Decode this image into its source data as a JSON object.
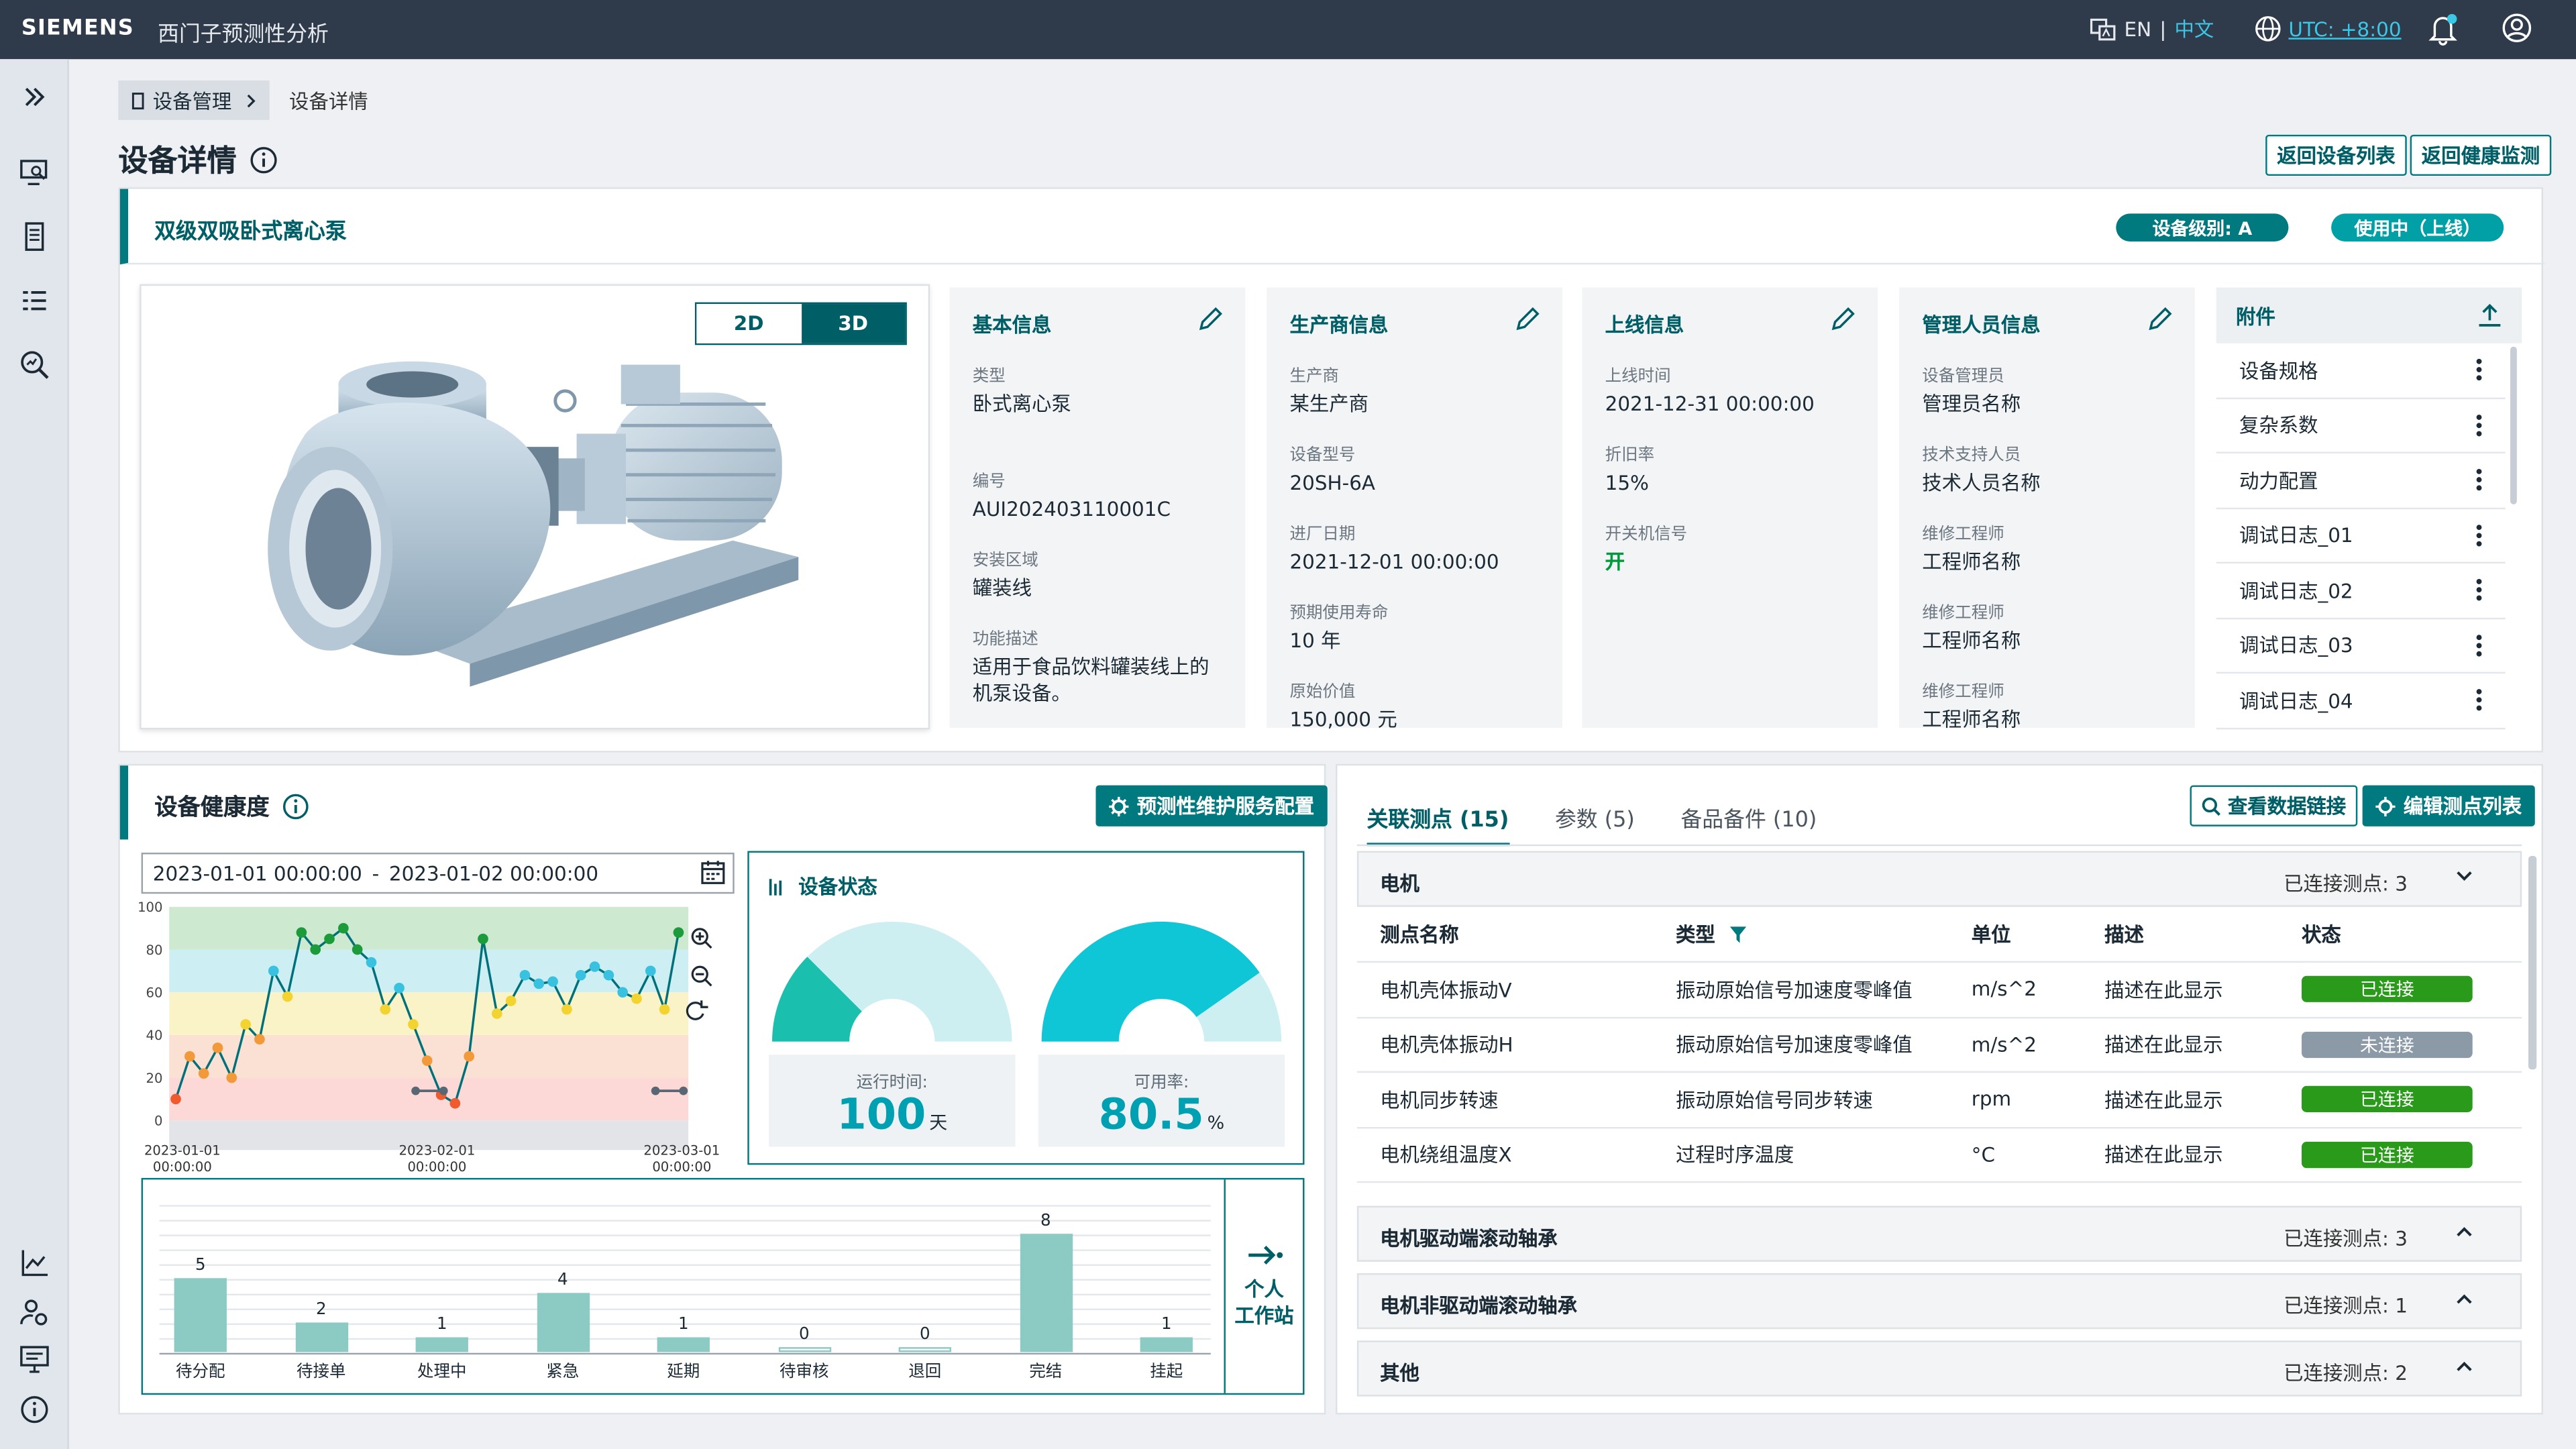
{
  "topbar": {
    "brand": "SIEMENS",
    "title": "西门子预测性分析",
    "lang_en": "EN",
    "lang_sep": "|",
    "lang_cn": "中文",
    "timezone": "UTC: +8:00"
  },
  "breadcrumb": {
    "parent": "设备管理",
    "current": "设备详情"
  },
  "page": {
    "title": "设备详情",
    "btn_list": "返回设备列表",
    "btn_health": "返回健康监测"
  },
  "equipment": {
    "name": "双级双吸卧式离心泵",
    "level": "设备级别: A",
    "status": "使用中（上线）",
    "view_2d": "2D",
    "view_3d": "3D"
  },
  "basic": {
    "title": "基本信息",
    "type_label": "类型",
    "type_value": "卧式离心泵",
    "code_label": "编号",
    "code_value": "AUI202403110001C",
    "area_label": "安装区域",
    "area_value": "罐装线",
    "desc_label": "功能描述",
    "desc_value": "适用于食品饮料罐装线上的机泵设备。"
  },
  "maker": {
    "title": "生产商信息",
    "maker_label": "生产商",
    "maker_value": "某生产商",
    "model_label": "设备型号",
    "model_value": "20SH-6A",
    "date_label": "进厂日期",
    "date_value": "2021-12-01 00:00:00",
    "life_label": "预期使用寿命",
    "life_value": "10 年",
    "price_label": "原始价值",
    "price_value": "150,000 元"
  },
  "online": {
    "title": "上线信息",
    "time_label": "上线时间",
    "time_value": "2021-12-31 00:00:00",
    "dep_label": "折旧率",
    "dep_value": "15%",
    "sig_label": "开关机信号",
    "sig_value": "开"
  },
  "staff": {
    "title": "管理人员信息",
    "mgr_label": "设备管理员",
    "mgr_value": "管理员名称",
    "tech_label": "技术支持人员",
    "tech_value": "技术人员名称",
    "eng1_label": "维修工程师",
    "eng1_value": "工程师名称",
    "eng2_label": "维修工程师",
    "eng2_value": "工程师名称",
    "eng3_label": "维修工程师",
    "eng3_value": "工程师名称"
  },
  "attachments": {
    "title": "附件",
    "items": [
      "设备规格",
      "复杂系数",
      "动力配置",
      "调试日志_01",
      "调试日志_02",
      "调试日志_03",
      "调试日志_04"
    ]
  },
  "health": {
    "title": "设备健康度",
    "config_btn": "预测性维护服务配置",
    "date_start": "2023-01-01  00:00:00",
    "date_sep": "-",
    "date_end": "2023-01-02  00:00:00",
    "status_title": "设备状态",
    "run_label": "运行时间:",
    "run_value": "100",
    "run_unit": "天",
    "avail_label": "可用率:",
    "avail_value": "80.5",
    "avail_unit": "%",
    "runtime_fraction": 0.25,
    "availability_fraction": 0.805,
    "workstation_1": "个人",
    "workstation_2": "工作站"
  },
  "chart_data": [
    {
      "type": "line",
      "ylim": [
        0,
        100
      ],
      "yticks": [
        "100",
        "80",
        "60",
        "40",
        "20",
        "0"
      ],
      "xticks": [
        {
          "d": "2023-01-01",
          "t": "00:00:00"
        },
        {
          "d": "2023-02-01",
          "t": "00:00:00"
        },
        {
          "d": "2023-03-01",
          "t": "00:00:00"
        }
      ],
      "values": [
        10,
        30,
        22,
        34,
        20,
        45,
        38,
        70,
        58,
        88,
        80,
        85,
        90,
        80,
        74,
        52,
        62,
        45,
        28,
        12,
        8,
        30,
        85,
        50,
        56,
        68,
        64,
        65,
        52,
        68,
        72,
        68,
        60,
        57,
        70,
        52,
        88
      ],
      "bands": [
        {
          "from": 80,
          "to": 100,
          "color": "#cde9cf"
        },
        {
          "from": 60,
          "to": 80,
          "color": "#cdeff4"
        },
        {
          "from": 40,
          "to": 60,
          "color": "#fbf3c8"
        },
        {
          "from": 20,
          "to": 40,
          "color": "#fbe1d3"
        },
        {
          "from": 0,
          "to": 20,
          "color": "#fcd9d6"
        }
      ]
    },
    {
      "type": "bar",
      "categories": [
        "待分配",
        "待接单",
        "处理中",
        "紧急",
        "延期",
        "待审核",
        "退回",
        "完结",
        "挂起"
      ],
      "values": [
        5,
        2,
        1,
        4,
        1,
        0,
        0,
        8,
        1
      ]
    }
  ],
  "points": {
    "tabs": [
      "关联测点 (15)",
      "参数 (5)",
      "备品备件 (10)"
    ],
    "btn_view": "查看数据链接",
    "btn_edit": "编辑测点列表",
    "group1": {
      "name": "电机",
      "count": "已连接测点: 3"
    },
    "columns": [
      "测点名称",
      "类型",
      "单位",
      "描述",
      "状态"
    ],
    "rows": [
      {
        "name": "电机壳体振动V",
        "type": "振动原始信号加速度零峰值",
        "unit": "m/s^2",
        "desc": "描述在此显示",
        "status": "已连接",
        "ok": true
      },
      {
        "name": "电机壳体振动H",
        "type": "振动原始信号加速度零峰值",
        "unit": "m/s^2",
        "desc": "描述在此显示",
        "status": "未连接",
        "ok": false
      },
      {
        "name": "电机同步转速",
        "type": "振动原始信号同步转速",
        "unit": "rpm",
        "desc": "描述在此显示",
        "status": "已连接",
        "ok": true
      },
      {
        "name": "电机绕组温度X",
        "type": "过程时序温度",
        "unit": "°C",
        "desc": "描述在此显示",
        "status": "已连接",
        "ok": true
      }
    ],
    "groups": [
      {
        "name": "电机驱动端滚动轴承",
        "count": "已连接测点: 3"
      },
      {
        "name": "电机非驱动端滚动轴承",
        "count": "已连接测点: 1"
      },
      {
        "name": "其他",
        "count": "已连接测点: 2"
      }
    ]
  }
}
